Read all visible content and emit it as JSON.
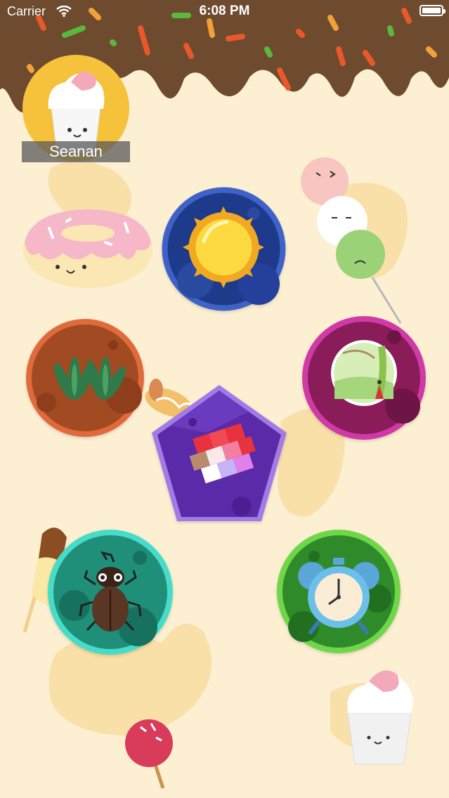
{
  "status_bar": {
    "carrier": "Carrier",
    "time": "6:08 PM"
  },
  "profile": {
    "name": "Seanan"
  },
  "colors": {
    "background": "#fcefd2",
    "chocolate": "#6e4a2e",
    "sun_level": "#3f62c8",
    "plant_level": "#e06a3c",
    "painting_level": "#cf3aa6",
    "puzzle_level": "#7b3fcf",
    "beetle_level": "#46dcc8",
    "clock_level": "#6fd64a"
  },
  "levels": [
    {
      "icon": "sun-icon"
    },
    {
      "icon": "plant-icon"
    },
    {
      "icon": "painting-icon"
    },
    {
      "icon": "puzzle-icon"
    },
    {
      "icon": "beetle-icon"
    },
    {
      "icon": "alarm-clock-icon"
    }
  ]
}
